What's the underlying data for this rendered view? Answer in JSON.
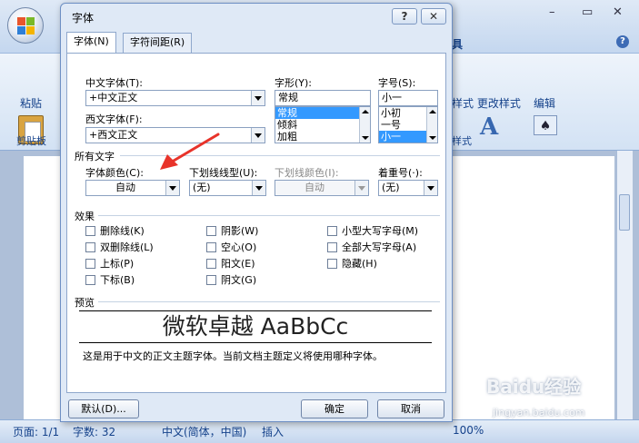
{
  "app": {
    "title_tab_right": "具",
    "help_label": "?",
    "ribbon": {
      "paste_label": "粘贴",
      "clipboard_group": "剪贴板",
      "change_style_label": "样式 更改样式",
      "styles_group": "样式",
      "edit_label": "编辑"
    },
    "window_controls": {
      "minimize": "–",
      "restore": "▭",
      "close": "✕"
    }
  },
  "dialog": {
    "title": "字体",
    "help_button": "?",
    "close_button": "✕",
    "tabs": [
      {
        "label": "字体(N)",
        "active": true
      },
      {
        "label": "字符间距(R)",
        "active": false
      }
    ],
    "chinese_font": {
      "label": "中文字体(T):",
      "value": "+中文正文"
    },
    "western_font": {
      "label": "西文字体(F):",
      "value": "+西文正文"
    },
    "font_style": {
      "label": "字形(Y):",
      "value": "常规",
      "options": [
        "常规",
        "倾斜",
        "加粗"
      ],
      "selected": "常规"
    },
    "font_size": {
      "label": "字号(S):",
      "value": "小一",
      "options": [
        "小初",
        "一号",
        "小一"
      ],
      "selected": "小一"
    },
    "all_text_section": "所有文字",
    "font_color": {
      "label": "字体颜色(C):",
      "value": "自动"
    },
    "underline_type": {
      "label": "下划线线型(U):",
      "value": "(无)"
    },
    "underline_color": {
      "label": "下划线颜色(I):",
      "value": "自动"
    },
    "emphasis_mark": {
      "label": "着重号(·):",
      "value": "(无)"
    },
    "effects_section": "效果",
    "effects": [
      {
        "label": "删除线(K)"
      },
      {
        "label": "阴影(W)"
      },
      {
        "label": "小型大写字母(M)"
      },
      {
        "label": "双删除线(L)"
      },
      {
        "label": "空心(O)"
      },
      {
        "label": "全部大写字母(A)"
      },
      {
        "label": "上标(P)"
      },
      {
        "label": "阳文(E)"
      },
      {
        "label": "隐藏(H)"
      },
      {
        "label": "下标(B)"
      },
      {
        "label": "阴文(G)"
      }
    ],
    "preview_section": "预览",
    "preview_text": "微软卓越  AaBbCc",
    "preview_note": "这是用于中文的正文主题字体。当前文档主题定义将使用哪种字体。",
    "default_button": "默认(D)...",
    "ok_button": "确定",
    "cancel_button": "取消"
  },
  "status_bar": {
    "page": "页面: 1/1",
    "words": "字数: 32",
    "language": "中文(简体，中国)",
    "mode": "插入",
    "zoom": "100%"
  },
  "watermark": {
    "brand": "Baidu经验",
    "url": "jingyan.baidu.com"
  },
  "colors": {
    "accent": "#15428b",
    "selection": "#3399ff",
    "annotation_arrow": "#e8332a"
  }
}
